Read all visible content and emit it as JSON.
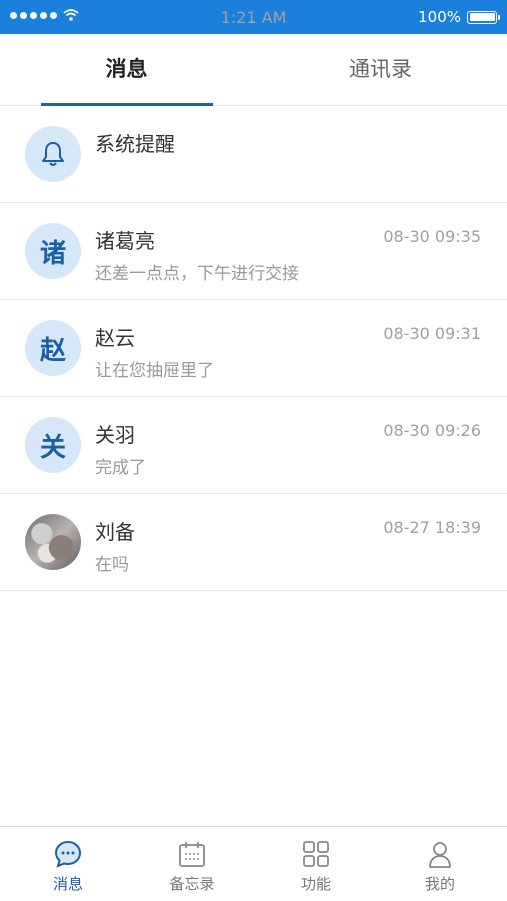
{
  "status_bar": {
    "time": "1:21 AM",
    "battery": "100%"
  },
  "tabs": [
    {
      "label": "消息",
      "active": true
    },
    {
      "label": "通讯录",
      "active": false
    }
  ],
  "messages": [
    {
      "name": "系统提醒",
      "preview": "",
      "time": "",
      "avatar": "bell-icon"
    },
    {
      "name": "诸葛亮",
      "preview": "还差一点点，下午进行交接",
      "time": "08-30 09:35",
      "avatar_char": "诸"
    },
    {
      "name": "赵云",
      "preview": "让在您抽屉里了",
      "time": "08-30 09:31",
      "avatar_char": "赵"
    },
    {
      "name": "关羽",
      "preview": "完成了",
      "time": "08-30 09:26",
      "avatar_char": "关"
    },
    {
      "name": "刘备",
      "preview": "在吗",
      "time": "08-27 18:39",
      "avatar": "photo"
    }
  ],
  "bottom_nav": [
    {
      "label": "消息",
      "icon": "chat-bubble-icon",
      "active": true
    },
    {
      "label": "备忘录",
      "icon": "calendar-icon",
      "active": false
    },
    {
      "label": "功能",
      "icon": "grid-icon",
      "active": false
    },
    {
      "label": "我的",
      "icon": "person-icon",
      "active": false
    }
  ],
  "colors": {
    "primary": "#1b7fdc",
    "accent": "#1b5fa6",
    "avatar_bg": "#d5e7f8"
  }
}
